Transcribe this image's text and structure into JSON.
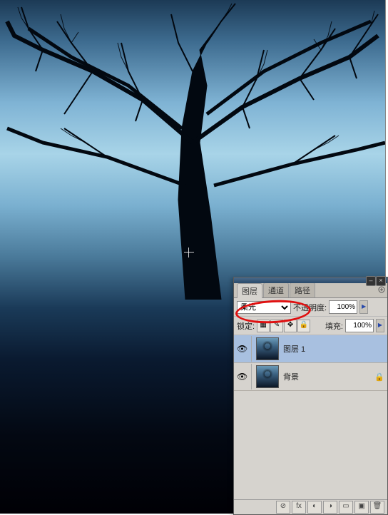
{
  "tabs": {
    "layers": "图层",
    "channels": "通道",
    "paths": "路径"
  },
  "blend_mode": {
    "selected": "柔光"
  },
  "opacity": {
    "label": "不透明度:",
    "value": "100%"
  },
  "lock": {
    "label": "锁定:"
  },
  "fill": {
    "label": "填充:",
    "value": "100%"
  },
  "layers": [
    {
      "name": "图层 1",
      "visible": true,
      "selected": true,
      "locked": false
    },
    {
      "name": "背景",
      "visible": true,
      "selected": false,
      "locked": true
    }
  ],
  "titlebar": {
    "minimize": "–",
    "close": "×"
  },
  "lock_icons": {
    "transparent": "▦",
    "brush": "✎",
    "move": "✥",
    "all": "🔒"
  },
  "footer": {
    "link": "⊘",
    "fx": "fx",
    "mask": "◐",
    "adjust": "◑",
    "folder": "▭",
    "new": "▣",
    "trash": "🗑"
  }
}
